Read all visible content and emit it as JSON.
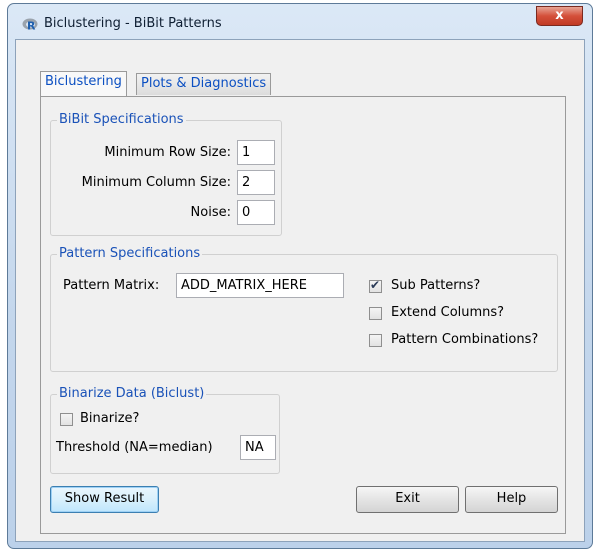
{
  "window": {
    "title": "Biclustering - BiBit Patterns",
    "close_label": "x"
  },
  "tabs": [
    {
      "label": "Biclustering",
      "active": true
    },
    {
      "label": "Plots & Diagnostics",
      "active": false
    }
  ],
  "bibit_spec": {
    "title": "BiBit Specifications",
    "min_row_label": "Minimum Row Size:",
    "min_row_value": "1",
    "min_col_label": "Minimum Column Size:",
    "min_col_value": "2",
    "noise_label": "Noise:",
    "noise_value": "0"
  },
  "pattern_spec": {
    "title": "Pattern Specifications",
    "matrix_label": "Pattern Matrix:",
    "matrix_value": "ADD_MATRIX_HERE",
    "checkboxes": [
      {
        "label": "Sub Patterns?",
        "checked": true
      },
      {
        "label": "Extend Columns?",
        "checked": false
      },
      {
        "label": "Pattern Combinations?",
        "checked": false
      }
    ]
  },
  "binarize": {
    "title": "Binarize Data (Biclust)",
    "checkbox_label": "Binarize?",
    "checked": false,
    "threshold_label": "Threshold (NA=median)",
    "threshold_value": "NA"
  },
  "buttons": {
    "show_result": "Show Result",
    "exit": "Exit",
    "help": "Help"
  },
  "colors": {
    "tab_text": "#0b4fc2",
    "group_title": "#1a52b8",
    "close": "#c03a25"
  }
}
